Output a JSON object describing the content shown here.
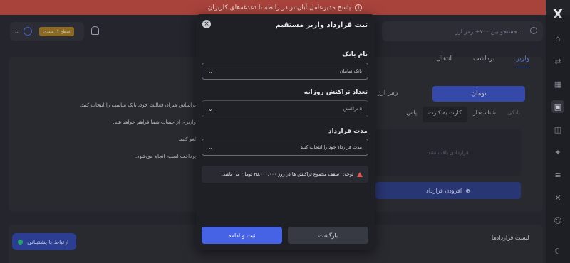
{
  "banner": {
    "text": "پاسخ مدیرعامل آبان‌تتر در رابطه با دغدغه‌های کاربران",
    "icon": "info-icon"
  },
  "header": {
    "search_placeholder": "جستجو بین ۷۰۰+ رمز ارز ...",
    "user_level": "سطح ۱: مبتدی",
    "logo": "X"
  },
  "background": {
    "tabs": [
      "واریز",
      "برداشت",
      "انتقال"
    ],
    "active_tab": "واریز",
    "currency_tab": "تومان",
    "crypto_tab": "رمز ارز",
    "methods": [
      "بانکی",
      "شناسه‌دار",
      "کارت به کارت",
      "پاس"
    ],
    "empty_text": "قراردادی یافت نشد",
    "add_contract": "افزودن قرارداد",
    "info_lines": [
      "براساس میزان فعالیت خود، بانک مناسب را انتخاب کنید.",
      "واریزی از حساب شما فراهم خواهد شد.",
      "لغو کنید.",
      "پرداخت است، انجام می‌شود."
    ],
    "contracts_list": "لیست قراردادها",
    "support": "ارتباط با پشتیبانی"
  },
  "modal": {
    "title": "ثبت قرارداد واریز مستقیم",
    "bank_label": "نام بانک",
    "bank_value": "بانک سامان",
    "daily_label": "تعداد تراکنش روزانه",
    "daily_value": "۵ تراکنش",
    "duration_label": "مدت قرارداد",
    "duration_placeholder": "مدت قرارداد خود را انتخاب کنید",
    "note_prefix": "توجه:",
    "note_text": "سقف مجموع تراکنش ها در روز ۲۵,۰۰۰,۰۰۰ تومان می باشد.",
    "back_button": "بازگشت",
    "submit_button": "ثبت و ادامه"
  },
  "colors": {
    "primary": "#4663e6",
    "banner": "#a8433c",
    "warning": "#e05555",
    "online": "#2ec27e"
  }
}
